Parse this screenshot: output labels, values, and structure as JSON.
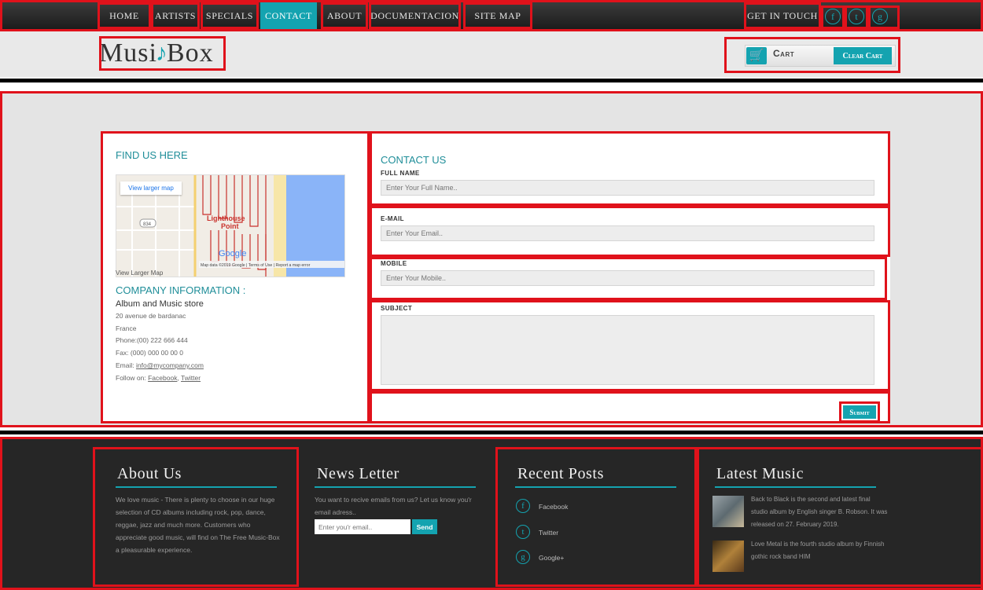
{
  "nav": {
    "items": [
      "Home",
      "Artists",
      "Specials",
      "Contact",
      "About",
      "Documentacion",
      "Site Map"
    ],
    "active": "Contact",
    "get_in_touch": "Get in Touch",
    "social": [
      "f",
      "t",
      "g"
    ]
  },
  "header": {
    "logo_left": "Musi",
    "logo_clef": "♪",
    "logo_right": "Box",
    "cart_label": "Cart",
    "clear_cart_label": "Clear Cart"
  },
  "find": {
    "title": "FIND US HERE",
    "view_larger_btn": "View larger map",
    "map_place": "Lighthouse\nPoint",
    "map_attrib": "Map data ©2019 Google | Terms of Use | Report a map error",
    "caption": "View Larger Map"
  },
  "company": {
    "title": "COMPANY INFORMATION :",
    "name": "Album and Music store",
    "address": "20 avenue de bardanac",
    "country": "France",
    "phone": "Phone:(00) 222 666 444",
    "fax": "Fax: (000) 000 00 00 0",
    "email_prefix": "Email: ",
    "email": "info@mycompany.com",
    "follow_prefix": "Follow on: ",
    "facebook": "Facebook",
    "twitter": "Twitter"
  },
  "contact": {
    "title": "CONTACT US",
    "full_name_label": "Full Name",
    "full_name_placeholder": "Enter Your Full Name..",
    "email_label": "E-mail",
    "email_placeholder": "Enter Your Email..",
    "mobile_label": "Mobile",
    "mobile_placeholder": "Enter Your Mobile..",
    "subject_label": "Subject",
    "submit_label": "Submit"
  },
  "footer": {
    "about_title": "About Us",
    "about_text": "We love music - There is plenty to choose in our huge selection of CD albums including rock, pop, dance, reggae, jazz and much more. Customers who appreciate good music, will find on The Free Music-Box a pleasurable experience.",
    "news_title": "News Letter",
    "news_text": "You want to recive emails from us? Let us know you'r email adress..",
    "news_placeholder": "Enter you'r email..",
    "news_send": "Send",
    "posts_title": "Recent Posts",
    "posts": [
      {
        "icon": "f",
        "label": "Facebook"
      },
      {
        "icon": "t",
        "label": "Twitter"
      },
      {
        "icon": "g",
        "label": "Google+"
      }
    ],
    "music_title": "Latest Music",
    "music": [
      "Back to Black is the second and latest final studio album by English singer B. Robson. It was released on 27. February 2019.",
      "Love Metal is the fourth studio album by Finnish gothic rock band HIM"
    ]
  },
  "colors": {
    "accent": "#14a3b0",
    "highlight": "#e0121b",
    "footer_bg": "#262626"
  }
}
